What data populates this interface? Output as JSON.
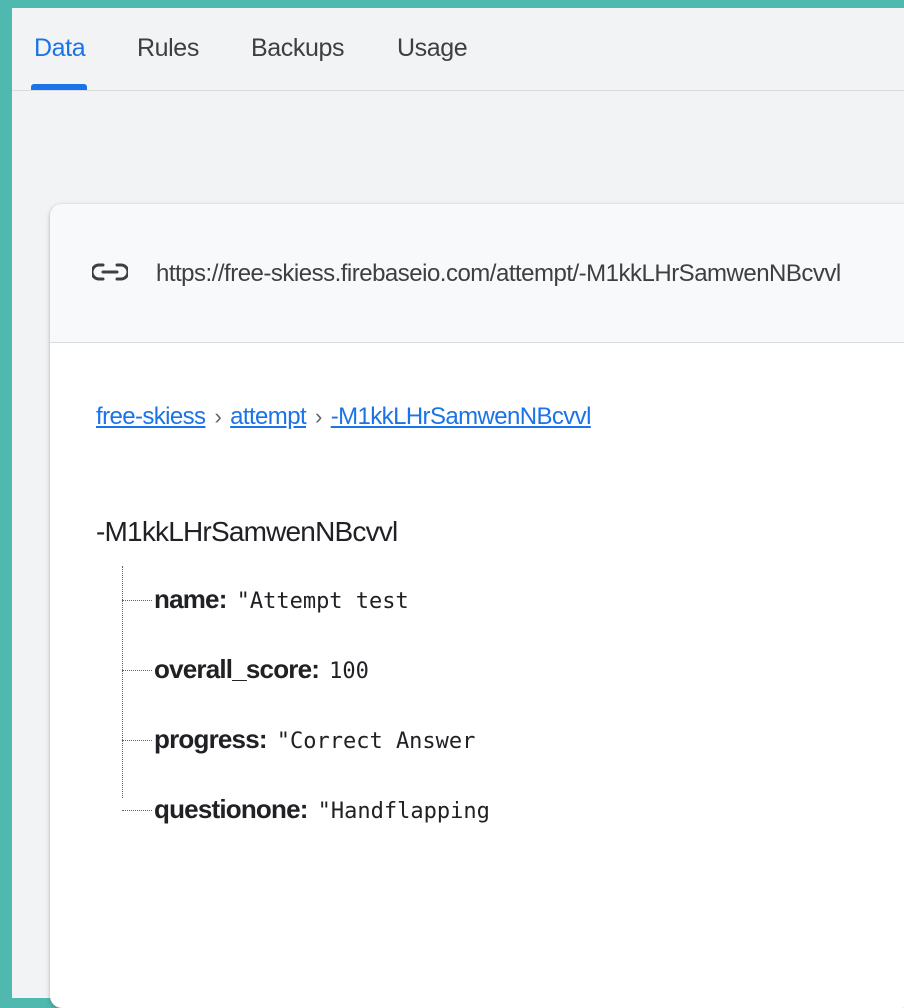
{
  "tabs": [
    {
      "label": "Data",
      "active": true
    },
    {
      "label": "Rules",
      "active": false
    },
    {
      "label": "Backups",
      "active": false
    },
    {
      "label": "Usage",
      "active": false
    }
  ],
  "url_bar": {
    "icon": "link-icon",
    "url": "https://free-skiess.firebaseio.com/attempt/-M1kkLHrSamwenNBcvvl"
  },
  "breadcrumb": [
    {
      "label": "free-skiess"
    },
    {
      "label": "attempt"
    },
    {
      "label": "-M1kkLHrSamwenNBcvvl"
    }
  ],
  "breadcrumb_separator": "›",
  "node": {
    "key": "-M1kkLHrSamwenNBcvvl",
    "children": [
      {
        "key": "name:",
        "value": "\"Attempt test"
      },
      {
        "key": "overall_score:",
        "value": "100"
      },
      {
        "key": "progress:",
        "value": "\"Correct Answer"
      },
      {
        "key": "questionone:",
        "value": "\"Handflapping"
      }
    ]
  },
  "colors": {
    "accent": "#1a73e8",
    "frame_background": "#4fb9b0",
    "page_background": "#f1f3f4"
  }
}
